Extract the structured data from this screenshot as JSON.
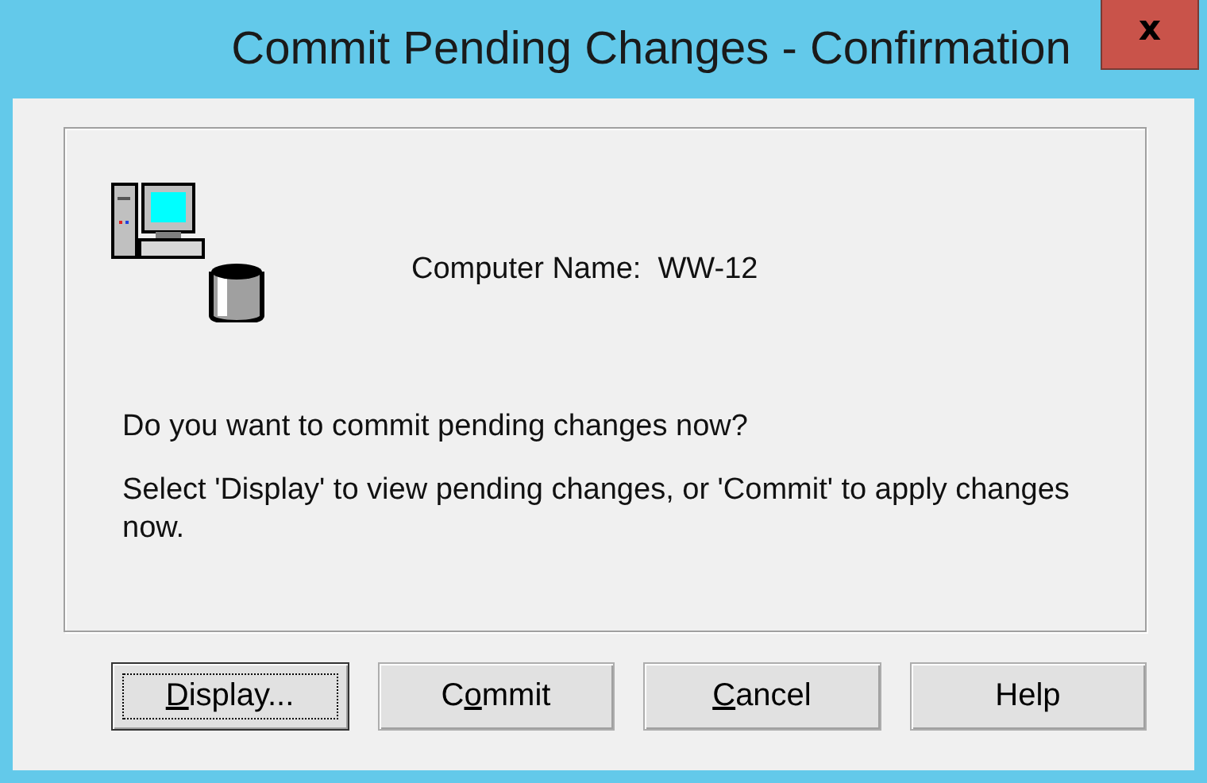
{
  "window": {
    "title": "Commit Pending Changes - Confirmation",
    "close": "x"
  },
  "info": {
    "label": "Computer Name:",
    "value": "WW-12"
  },
  "question": "Do you want to commit pending changes now?",
  "instructions": "Select 'Display' to view pending changes, or 'Commit' to apply changes now.",
  "buttons": [
    {
      "label": [
        {
          "text": "D",
          "underlined": true
        },
        {
          "text": "isplay...",
          "underlined": false
        }
      ],
      "focused": true
    },
    {
      "label": [
        {
          "text": "C",
          "underlined": false
        },
        {
          "text": "o",
          "underlined": true
        },
        {
          "text": "mmit",
          "underlined": false
        }
      ],
      "focused": false
    },
    {
      "label": [
        {
          "text": "C",
          "underlined": true
        },
        {
          "text": "ancel",
          "underlined": false
        }
      ],
      "focused": false
    },
    {
      "label": [
        {
          "text": "Help",
          "underlined": false
        }
      ],
      "focused": false
    }
  ]
}
